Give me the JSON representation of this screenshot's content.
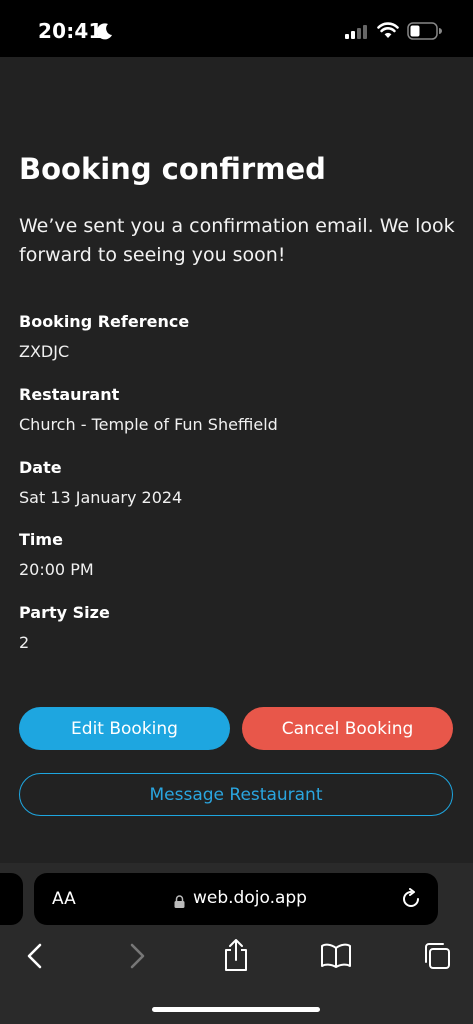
{
  "status_bar": {
    "time": "20:41"
  },
  "booking": {
    "title": "Booking confirmed",
    "subtitle": "We’ve sent you a confirmation email. We look forward to seeing you soon!",
    "details": [
      {
        "label": "Booking Reference",
        "value": "ZXDJC"
      },
      {
        "label": "Restaurant",
        "value": "Church - Temple of Fun Sheffield"
      },
      {
        "label": "Date",
        "value": "Sat 13 January 2024"
      },
      {
        "label": "Time",
        "value": "20:00 PM"
      },
      {
        "label": "Party Size",
        "value": "2"
      }
    ],
    "buttons": {
      "edit": "Edit Booking",
      "cancel": "Cancel Booking",
      "message": "Message Restaurant"
    }
  },
  "browser": {
    "text_size_label": "AA",
    "url": "web.dojo.app"
  },
  "colors": {
    "accent_blue": "#1ea6e0",
    "cancel_red": "#e8574a",
    "background": "#222222"
  }
}
